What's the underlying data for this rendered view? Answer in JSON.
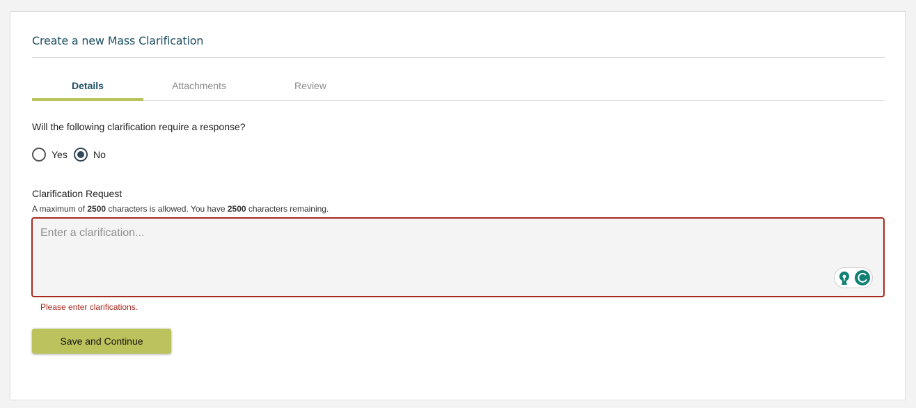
{
  "page": {
    "title": "Create a new Mass Clarification"
  },
  "tabs": [
    {
      "label": "Details",
      "active": true
    },
    {
      "label": "Attachments",
      "active": false
    },
    {
      "label": "Review",
      "active": false
    }
  ],
  "response_question": {
    "text": "Will the following clarification require a response?",
    "options": [
      {
        "label": "Yes",
        "selected": false
      },
      {
        "label": "No",
        "selected": true
      }
    ]
  },
  "clarification": {
    "label": "Clarification Request",
    "char_info_prefix": "A maximum of",
    "max_chars": "2500",
    "char_info_middle": "characters is allowed. You have",
    "remaining_chars": "2500",
    "char_info_suffix": "characters remaining.",
    "placeholder": "Enter a clarification...",
    "value": "",
    "error": "Please enter clarifications."
  },
  "actions": {
    "save_label": "Save and Continue"
  },
  "icons": {
    "assist_left": "lightbulb-icon",
    "assist_right": "grammar-check-icon"
  },
  "colors": {
    "accent": "#b9c25b",
    "title": "#1d4f63",
    "error": "#a72a1e",
    "assist": "#0f8074"
  }
}
